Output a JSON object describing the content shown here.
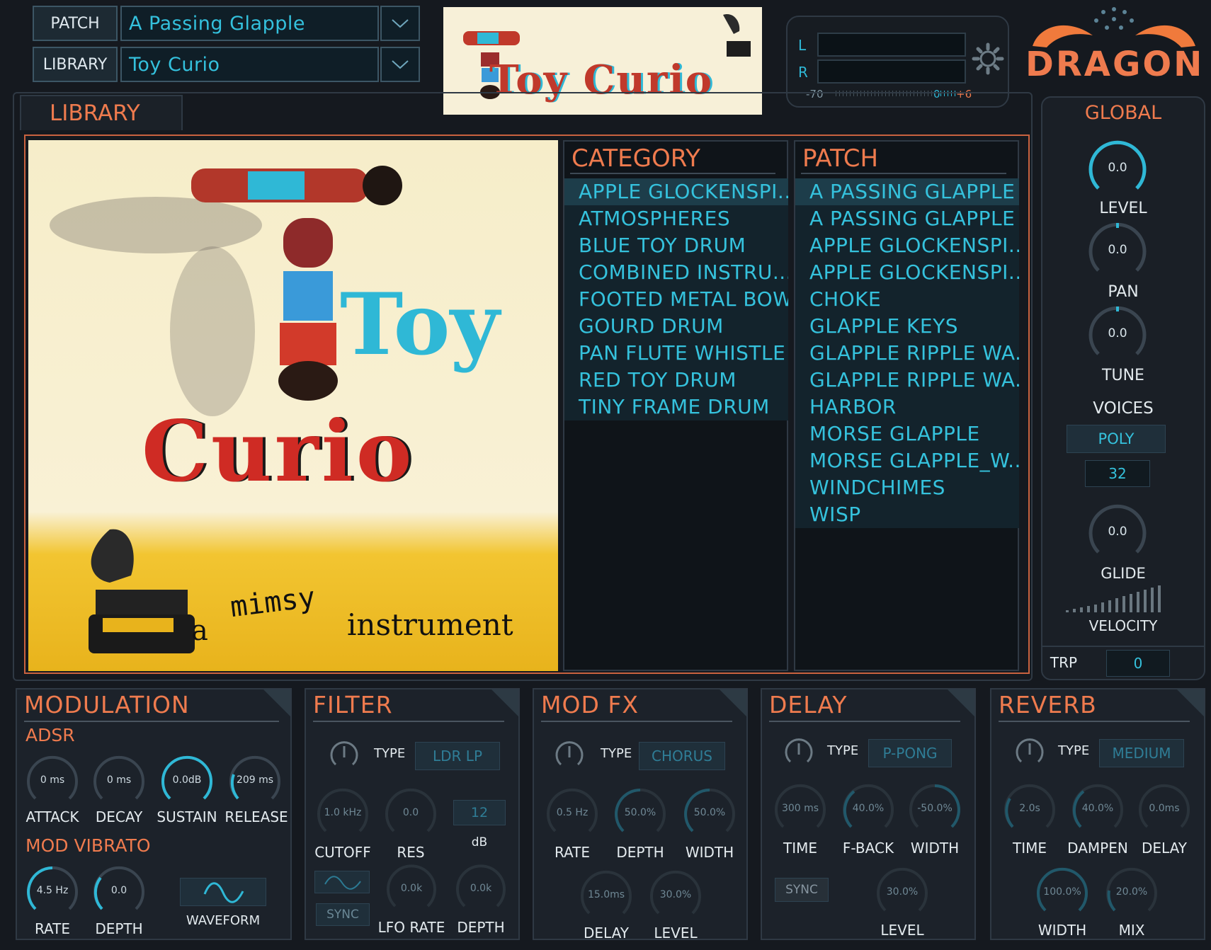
{
  "header": {
    "patch_label": "PATCH",
    "patch_value": "A Passing Glapple",
    "library_label": "LIBRARY",
    "library_value": "Toy Curio",
    "banner_text": "Toy Curio",
    "meter": {
      "l": "L",
      "r": "R",
      "min": "-70",
      "zero": "0",
      "max": "+6"
    },
    "logo": "DRAGON"
  },
  "library": {
    "tab": "LIBRARY",
    "artwork": {
      "title_a": "Toy",
      "title_b": "Curio",
      "tagline_a": "a",
      "tagline_b": "mimsy",
      "tagline_c": "instrument"
    },
    "category_header": "CATEGORY",
    "categories": [
      "APPLE GLOCKENSPI...",
      "ATMOSPHERES",
      "BLUE TOY DRUM",
      "COMBINED INSTRU...",
      "FOOTED METAL BOW",
      "GOURD DRUM",
      "PAN FLUTE WHISTLE",
      "RED TOY DRUM",
      "TINY FRAME DRUM"
    ],
    "patch_header": "PATCH",
    "patches": [
      "A PASSING GLAPPLE",
      "A PASSING GLAPPLE",
      "APPLE GLOCKENSPI...",
      "APPLE GLOCKENSPI...",
      "CHOKE",
      "GLAPPLE KEYS",
      "GLAPPLE RIPPLE WA...",
      "GLAPPLE RIPPLE WA...",
      "HARBOR",
      "MORSE GLAPPLE",
      "MORSE GLAPPLE_W...",
      "WINDCHIMES",
      "WISP"
    ]
  },
  "global": {
    "title": "GLOBAL",
    "level": {
      "label": "LEVEL",
      "value": "0.0"
    },
    "pan": {
      "label": "PAN",
      "value": "0.0"
    },
    "tune": {
      "label": "TUNE",
      "value": "0.0"
    },
    "voices_label": "VOICES",
    "voices_mode": "POLY",
    "voices_count": "32",
    "glide": {
      "label": "GLIDE",
      "value": "0.0"
    },
    "velocity_label": "VELOCITY",
    "trp_label": "TRP",
    "trp_value": "0"
  },
  "modulation": {
    "title": "MODULATION",
    "adsr_label": "ADSR",
    "attack": {
      "label": "ATTACK",
      "value": "0 ms"
    },
    "decay": {
      "label": "DECAY",
      "value": "0 ms"
    },
    "sustain": {
      "label": "SUSTAIN",
      "value": "0.0dB"
    },
    "release": {
      "label": "RELEASE",
      "value": "209 ms"
    },
    "vibrato_label": "MOD VIBRATO",
    "rate": {
      "label": "RATE",
      "value": "4.5 Hz"
    },
    "depth": {
      "label": "DEPTH",
      "value": "0.0"
    },
    "waveform_label": "WAVEFORM"
  },
  "filter": {
    "title": "FILTER",
    "type_label": "TYPE",
    "type_value": "LDR LP",
    "cutoff": {
      "label": "CUTOFF",
      "value": "1.0 kHz"
    },
    "res": {
      "label": "RES",
      "value": "0.0"
    },
    "db_value": "12",
    "db_label": "dB",
    "sync_label": "SYNC",
    "lfo_rate": {
      "label": "LFO RATE",
      "value": "0.0k"
    },
    "depth": {
      "label": "DEPTH",
      "value": "0.0k"
    }
  },
  "modfx": {
    "title": "MOD FX",
    "type_label": "TYPE",
    "type_value": "CHORUS",
    "rate": {
      "label": "RATE",
      "value": "0.5 Hz"
    },
    "depth": {
      "label": "DEPTH",
      "value": "50.0%"
    },
    "width": {
      "label": "WIDTH",
      "value": "50.0%"
    },
    "delay": {
      "label": "DELAY",
      "value": "15.0ms"
    },
    "level": {
      "label": "LEVEL",
      "value": "30.0%"
    }
  },
  "delay": {
    "title": "DELAY",
    "type_label": "TYPE",
    "type_value": "P-PONG",
    "time": {
      "label": "TIME",
      "value": "300 ms"
    },
    "fback": {
      "label": "F-BACK",
      "value": "40.0%"
    },
    "width": {
      "label": "WIDTH",
      "value": "-50.0%"
    },
    "sync_label": "SYNC",
    "level": {
      "label": "LEVEL",
      "value": "30.0%"
    }
  },
  "reverb": {
    "title": "REVERB",
    "type_label": "TYPE",
    "type_value": "MEDIUM",
    "time": {
      "label": "TIME",
      "value": "2.0s"
    },
    "dampen": {
      "label": "DAMPEN",
      "value": "40.0%"
    },
    "delay": {
      "label": "DELAY",
      "value": "0.0ms"
    },
    "width": {
      "label": "WIDTH",
      "value": "100.0%"
    },
    "mix": {
      "label": "MIX",
      "value": "20.0%"
    }
  },
  "colors": {
    "accent": "#ef7b4e",
    "highlight": "#2fb8d6",
    "background": "#15191f"
  }
}
